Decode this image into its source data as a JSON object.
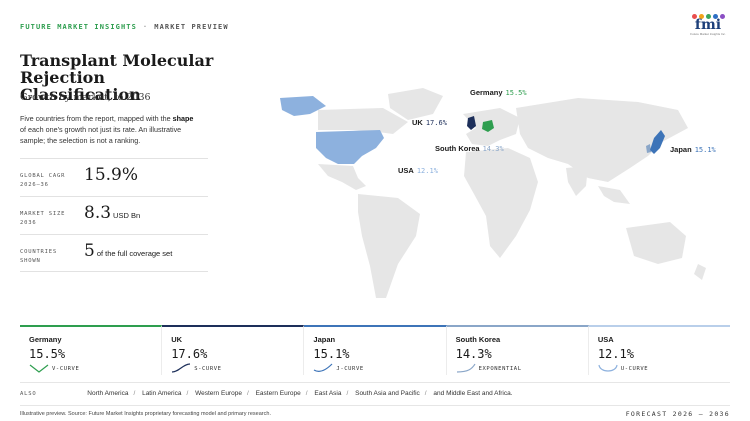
{
  "header": {
    "brand": "FUTURE MARKET INSIGHTS",
    "separator": "·",
    "section": "MARKET PREVIEW",
    "logo_text": "fmi",
    "logo_tagline": "Future Market Insights Inc.",
    "logo_dot_colors": [
      "#e94e4e",
      "#f2a31a",
      "#3aa55d",
      "#2d6fc4",
      "#8b4fc4"
    ]
  },
  "title": "Transplant Molecular Rejection Classification",
  "subtitle": "Growth by market, to 2036",
  "intro": {
    "before": "Five countries from the report, mapped with the ",
    "bold": "shape",
    "after": " of each one's growth not just its rate. An illustrative sample; the selection is not a ranking."
  },
  "stats": [
    {
      "label": "GLOBAL CAGR 2026–36",
      "value": "15.9%",
      "unit": ""
    },
    {
      "label": "MARKET SIZE 2036",
      "value": "8.3",
      "unit": "USD Bn"
    },
    {
      "label": "COUNTRIES SHOWN",
      "value": "5",
      "unit": "of the full coverage set"
    }
  ],
  "map_labels": [
    {
      "country": "Germany",
      "pct": "15.5%",
      "color": "#2e9e4f"
    },
    {
      "country": "UK",
      "pct": "17.6%",
      "color": "#1d2f5a"
    },
    {
      "country": "South Korea",
      "pct": "14.3%",
      "color": "#8aa6c8"
    },
    {
      "country": "USA",
      "pct": "12.1%",
      "color": "#8db1de"
    },
    {
      "country": "Japan",
      "pct": "15.1%",
      "color": "#3d74b8"
    }
  ],
  "cards": [
    {
      "country": "Germany",
      "value": "15.5%",
      "curve": "V-CURVE",
      "accent": "#2e9e4f"
    },
    {
      "country": "UK",
      "value": "17.6%",
      "curve": "S-CURVE",
      "accent": "#1d2f5a"
    },
    {
      "country": "Japan",
      "value": "15.1%",
      "curve": "J-CURVE",
      "accent": "#3d74b8"
    },
    {
      "country": "South Korea",
      "value": "14.3%",
      "curve": "EXPONENTIAL",
      "accent": "#8aa6c8"
    },
    {
      "country": "USA",
      "value": "12.1%",
      "curve": "U-CURVE",
      "accent": "#b9cfea"
    }
  ],
  "also": {
    "label": "ALSO",
    "regions": [
      "North America",
      "Latin America",
      "Western Europe",
      "Eastern Europe",
      "East Asia",
      "South Asia and Pacific",
      "and Middle East and Africa."
    ]
  },
  "footer": {
    "source": "Illustrative preview. Source: Future Market Insights proprietary forecasting model and primary research.",
    "forecast": "FORECAST 2026 – 2036"
  }
}
